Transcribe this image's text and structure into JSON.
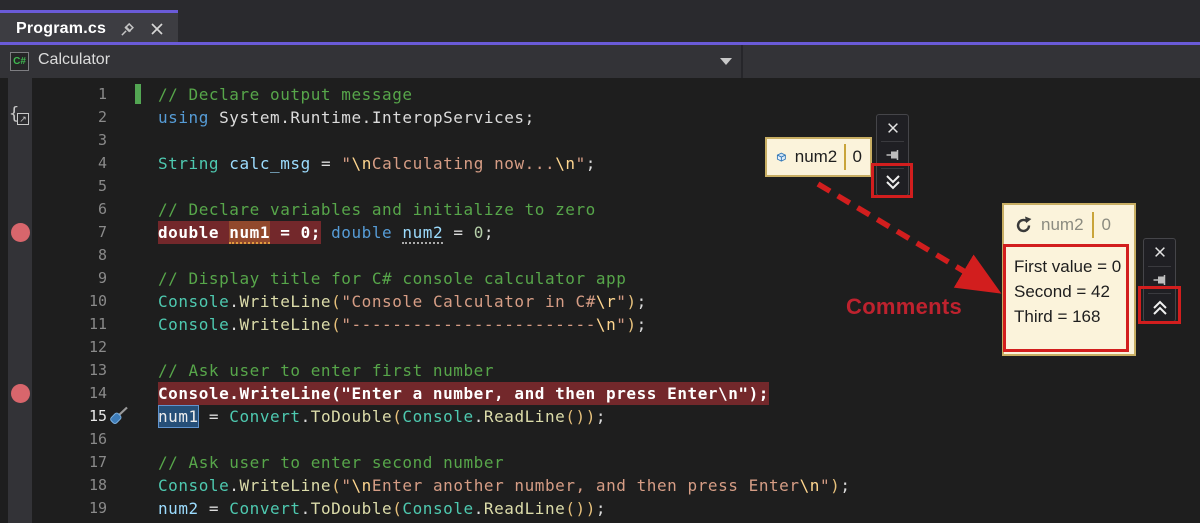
{
  "tab": {
    "title": "Program.cs"
  },
  "navbar": {
    "file_icon_label": "C#",
    "project": "Calculator"
  },
  "annotations": {
    "comments_label": "Comments"
  },
  "datatip_pinned": {
    "name": "num2",
    "value": "0"
  },
  "datatip_expanded": {
    "name": "num2",
    "value": "0",
    "comments": [
      "First value = 0",
      "Second = 42",
      "Third = 168"
    ]
  },
  "colors": {
    "accent_purple": "#6A5BD8",
    "breakpoint_red": "#D8666C",
    "breakpoint_line_bg": "#73282B",
    "annotation_red": "#D21E1E",
    "datatip_bg": "#FBF3DB",
    "selection_blue": "#264F78",
    "comment_green": "#57A64A"
  },
  "code": {
    "lines": [
      {
        "n": 1,
        "changebar": true,
        "tokens": [
          [
            "cm",
            "// Declare output message"
          ]
        ]
      },
      {
        "n": 2,
        "glyph": "brace-export",
        "tokens": [
          [
            "kw",
            "using"
          ],
          [
            "pl",
            " System.Runtime.InteropServices;"
          ]
        ]
      },
      {
        "n": 3,
        "tokens": []
      },
      {
        "n": 4,
        "tokens": [
          [
            "ty",
            "String"
          ],
          [
            "pl",
            " "
          ],
          [
            "va",
            "calc_msg"
          ],
          [
            "pl",
            " = "
          ],
          [
            "st",
            "\""
          ],
          [
            "es",
            "\\n"
          ],
          [
            "st",
            "Calculating now..."
          ],
          [
            "es",
            "\\n"
          ],
          [
            "st",
            "\""
          ],
          [
            "pl",
            ";"
          ]
        ]
      },
      {
        "n": 5,
        "tokens": []
      },
      {
        "n": 6,
        "tokens": [
          [
            "cm",
            "// Declare variables and initialize to zero"
          ]
        ]
      },
      {
        "n": 7,
        "bp": true,
        "tokens": [
          [
            "hw",
            "double "
          ],
          [
            "hn1",
            "num1"
          ],
          [
            "hw",
            " = 0;"
          ],
          [
            "pl",
            " "
          ],
          [
            "kw",
            "double"
          ],
          [
            "pl",
            " "
          ],
          [
            "vad",
            "num2"
          ],
          [
            "pl",
            " = "
          ],
          [
            "nu",
            "0"
          ],
          [
            "pl",
            ";"
          ]
        ]
      },
      {
        "n": 8,
        "tokens": []
      },
      {
        "n": 9,
        "tokens": [
          [
            "cm",
            "// Display title for C# console calculator app"
          ]
        ]
      },
      {
        "n": 10,
        "tokens": [
          [
            "ty",
            "Console"
          ],
          [
            "pl",
            "."
          ],
          [
            "me",
            "WriteLine"
          ],
          [
            "pa",
            "("
          ],
          [
            "st",
            "\"Console Calculator in C#"
          ],
          [
            "es",
            "\\r"
          ],
          [
            "st",
            "\""
          ],
          [
            "pa",
            ")"
          ],
          [
            "pl",
            ";"
          ]
        ]
      },
      {
        "n": 11,
        "tokens": [
          [
            "ty",
            "Console"
          ],
          [
            "pl",
            "."
          ],
          [
            "me",
            "WriteLine"
          ],
          [
            "pa",
            "("
          ],
          [
            "st",
            "\"------------------------"
          ],
          [
            "es",
            "\\n"
          ],
          [
            "st",
            "\""
          ],
          [
            "pa",
            ")"
          ],
          [
            "pl",
            ";"
          ]
        ]
      },
      {
        "n": 12,
        "tokens": []
      },
      {
        "n": 13,
        "tokens": [
          [
            "cm",
            "// Ask user to enter first number"
          ]
        ]
      },
      {
        "n": 14,
        "bp": true,
        "tokens": [
          [
            "hw",
            "Console.WriteLine(\"Enter a number, and then press Enter\\n\");"
          ]
        ]
      },
      {
        "n": 15,
        "pin": true,
        "brightNum": true,
        "tokens": [
          [
            "sel",
            "num1"
          ],
          [
            "pl",
            " = "
          ],
          [
            "ty",
            "Convert"
          ],
          [
            "pl",
            "."
          ],
          [
            "me",
            "ToDouble"
          ],
          [
            "pa",
            "("
          ],
          [
            "ty",
            "Console"
          ],
          [
            "pl",
            "."
          ],
          [
            "me",
            "ReadLine"
          ],
          [
            "pa",
            "()"
          ],
          [
            "pa",
            ")"
          ],
          [
            "pl",
            ";"
          ]
        ]
      },
      {
        "n": 16,
        "tokens": []
      },
      {
        "n": 17,
        "tokens": [
          [
            "cm",
            "// Ask user to enter second number"
          ]
        ]
      },
      {
        "n": 18,
        "tokens": [
          [
            "ty",
            "Console"
          ],
          [
            "pl",
            "."
          ],
          [
            "me",
            "WriteLine"
          ],
          [
            "pa",
            "("
          ],
          [
            "st",
            "\""
          ],
          [
            "es",
            "\\n"
          ],
          [
            "st",
            "Enter another number, and then press Enter"
          ],
          [
            "es",
            "\\n"
          ],
          [
            "st",
            "\""
          ],
          [
            "pa",
            ")"
          ],
          [
            "pl",
            ";"
          ]
        ]
      },
      {
        "n": 19,
        "tokens": [
          [
            "va",
            "num2"
          ],
          [
            "pl",
            " = "
          ],
          [
            "ty",
            "Convert"
          ],
          [
            "pl",
            "."
          ],
          [
            "me",
            "ToDouble"
          ],
          [
            "pa",
            "("
          ],
          [
            "ty",
            "Console"
          ],
          [
            "pl",
            "."
          ],
          [
            "me",
            "ReadLine"
          ],
          [
            "pa",
            "()"
          ],
          [
            "pa",
            ")"
          ],
          [
            "pl",
            ";"
          ]
        ]
      }
    ]
  }
}
